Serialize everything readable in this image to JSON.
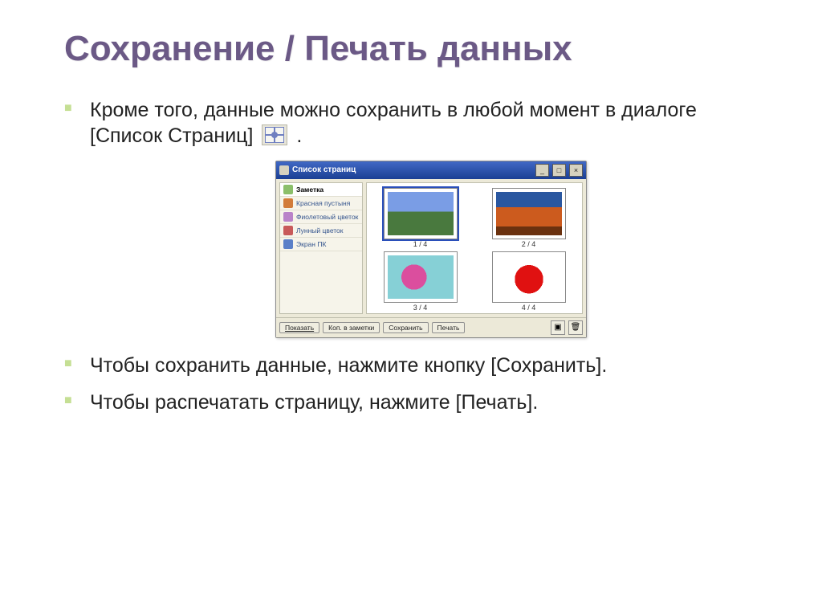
{
  "title": "Сохранение / Печать данных",
  "bullets": {
    "b1_pre": "Кроме того, данные можно сохранить в любой момент в диалоге [Список Страниц] ",
    "b1_post": " .",
    "b2": "Чтобы сохранить данные, нажмите кнопку [Сохранить].",
    "b3": "Чтобы распечатать страницу, нажмите [Печать]."
  },
  "dialog": {
    "title": "Список страниц",
    "window_min": "_",
    "window_max": "□",
    "window_close": "×",
    "sidebar": [
      {
        "label": "Заметка",
        "color": "#8bbf6a"
      },
      {
        "label": "Красная пустыня",
        "color": "#d27c3a"
      },
      {
        "label": "Фиолетовый цветок",
        "color": "#b983c9"
      },
      {
        "label": "Лунный цветок",
        "color": "#c85a5a"
      },
      {
        "label": "Экран ПК",
        "color": "#5a7fc8"
      }
    ],
    "thumbs": [
      {
        "cap": "1 / 4"
      },
      {
        "cap": "2 / 4"
      },
      {
        "cap": "3 / 4"
      },
      {
        "cap": "4 / 4"
      }
    ],
    "buttons": {
      "show": "Показать",
      "copy": "Коп. в заметки",
      "save": "Сохранить",
      "print": "Печать"
    }
  }
}
